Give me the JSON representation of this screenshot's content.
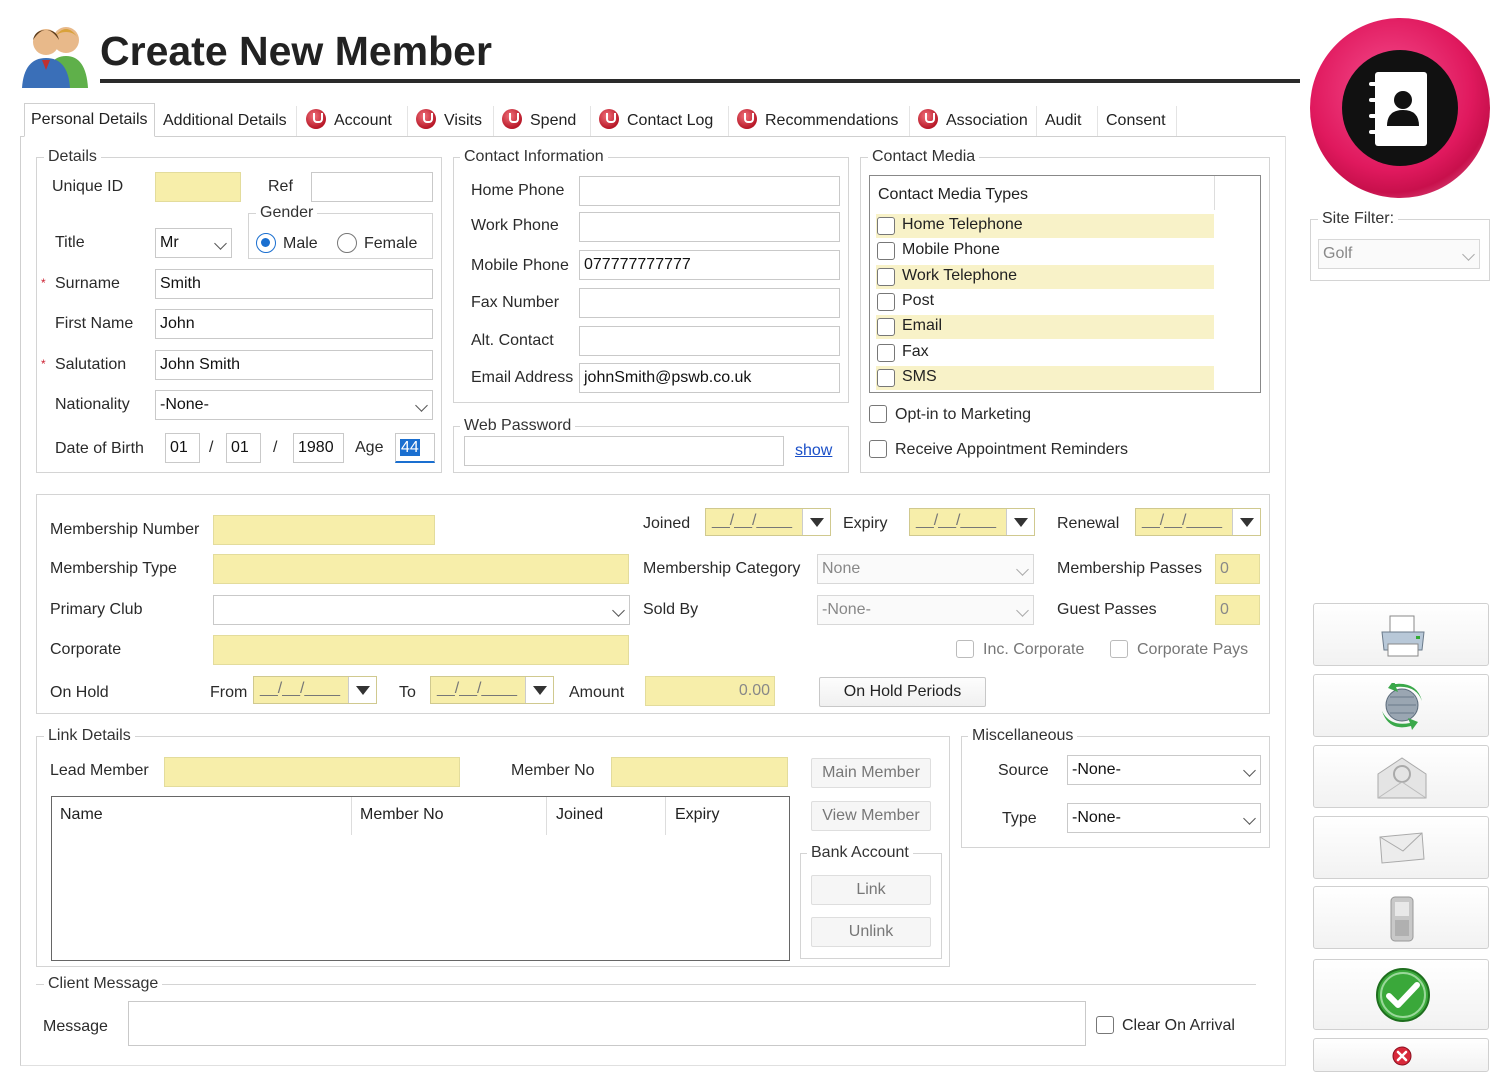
{
  "title": "Create New Member",
  "tabs": [
    {
      "label": "Personal Details",
      "icon": "",
      "active": true
    },
    {
      "label": "Additional Details",
      "icon": ""
    },
    {
      "label": "Account",
      "icon": "warning-icon"
    },
    {
      "label": "Visits",
      "icon": "warning-icon"
    },
    {
      "label": "Spend",
      "icon": "warning-icon"
    },
    {
      "label": "Contact Log",
      "icon": "warning-icon"
    },
    {
      "label": "Recommendations",
      "icon": "warning-icon"
    },
    {
      "label": "Association",
      "icon": "warning-icon"
    },
    {
      "label": "Audit",
      "icon": ""
    },
    {
      "label": "Consent",
      "icon": ""
    }
  ],
  "details": {
    "group_title": "Details",
    "unique_id_label": "Unique ID",
    "unique_id": "",
    "ref_label": "Ref",
    "ref": "",
    "gender_label": "Gender",
    "male_label": "Male",
    "female_label": "Female",
    "gender": "Male",
    "title_label": "Title",
    "title_value": "Mr",
    "surname_label": "Surname",
    "surname": "Smith",
    "first_name_label": "First Name",
    "first_name": "John",
    "salutation_label": "Salutation",
    "salutation": "John Smith",
    "nationality_label": "Nationality",
    "nationality": "-None-",
    "dob_label": "Date of Birth",
    "dob_day": "01",
    "dob_month": "01",
    "dob_year": "1980",
    "sep": "/",
    "age_label": "Age",
    "age": "44",
    "required_mark": "*"
  },
  "contact_info": {
    "group_title": "Contact Information",
    "home_phone_label": "Home Phone",
    "home_phone": "",
    "work_phone_label": "Work Phone",
    "work_phone": "",
    "mobile_phone_label": "Mobile Phone",
    "mobile_phone": "077777777777",
    "fax_label": "Fax Number",
    "fax": "",
    "alt_contact_label": "Alt. Contact",
    "alt_contact": "",
    "email_label": "Email Address",
    "email": "johnSmith@pswb.co.uk"
  },
  "web_password": {
    "group_title": "Web Password",
    "value": "",
    "show_link": "show"
  },
  "contact_media": {
    "group_title": "Contact Media",
    "list_header": "Contact Media Types",
    "items": [
      "Home Telephone",
      "Mobile Phone",
      "Work Telephone",
      "Post",
      "Email",
      "Fax",
      "SMS"
    ],
    "opt_in_label": "Opt-in to Marketing",
    "reminders_label": "Receive Appointment Reminders"
  },
  "site_filter": {
    "label": "Site Filter:",
    "value": "Golf"
  },
  "membership": {
    "number_label": "Membership Number",
    "number": "",
    "joined_label": "Joined",
    "joined": "__/__/____",
    "expiry_label": "Expiry",
    "expiry": "__/__/____",
    "renewal_label": "Renewal",
    "renewal": "__/__/____",
    "type_label": "Membership Type",
    "type": "",
    "category_label": "Membership Category",
    "category": "None",
    "passes_label": "Membership Passes",
    "passes": "0",
    "primary_club_label": "Primary Club",
    "primary_club": "",
    "sold_by_label": "Sold By",
    "sold_by": "-None-",
    "guest_passes_label": "Guest Passes",
    "guest_passes": "0",
    "corporate_label": "Corporate",
    "corporate": "",
    "inc_corporate_label": "Inc. Corporate",
    "corporate_pays_label": "Corporate Pays",
    "on_hold_label": "On Hold",
    "from_label": "From",
    "from": "__/__/____",
    "to_label": "To",
    "to": "__/__/____",
    "amount_label": "Amount",
    "amount": "0.00",
    "on_hold_periods_button": "On Hold Periods"
  },
  "link_details": {
    "group_title": "Link Details",
    "lead_member_label": "Lead Member",
    "lead_member": "",
    "member_no_label": "Member No",
    "member_no": "",
    "main_member_button": "Main Member",
    "view_member_button": "View Member",
    "columns": [
      "Name",
      "Member No",
      "Joined",
      "Expiry"
    ],
    "bank_account_title": "Bank Account",
    "link_button": "Link",
    "unlink_button": "Unlink"
  },
  "misc": {
    "group_title": "Miscellaneous",
    "source_label": "Source",
    "source": "-None-",
    "type_label": "Type",
    "type": "-None-"
  },
  "client_message": {
    "group_title": "Client Message",
    "message_label": "Message",
    "message": "",
    "clear_on_arrival_label": "Clear On Arrival"
  },
  "side_buttons": [
    "print-icon",
    "refresh-globe-icon",
    "email-icon",
    "envelope-icon",
    "mobile-phone-icon",
    "confirm-check-icon",
    "cancel-icon"
  ],
  "colors": {
    "accent": "#e0195e",
    "highlight": "#f7eeaa",
    "radio": "#1a6fd0"
  }
}
